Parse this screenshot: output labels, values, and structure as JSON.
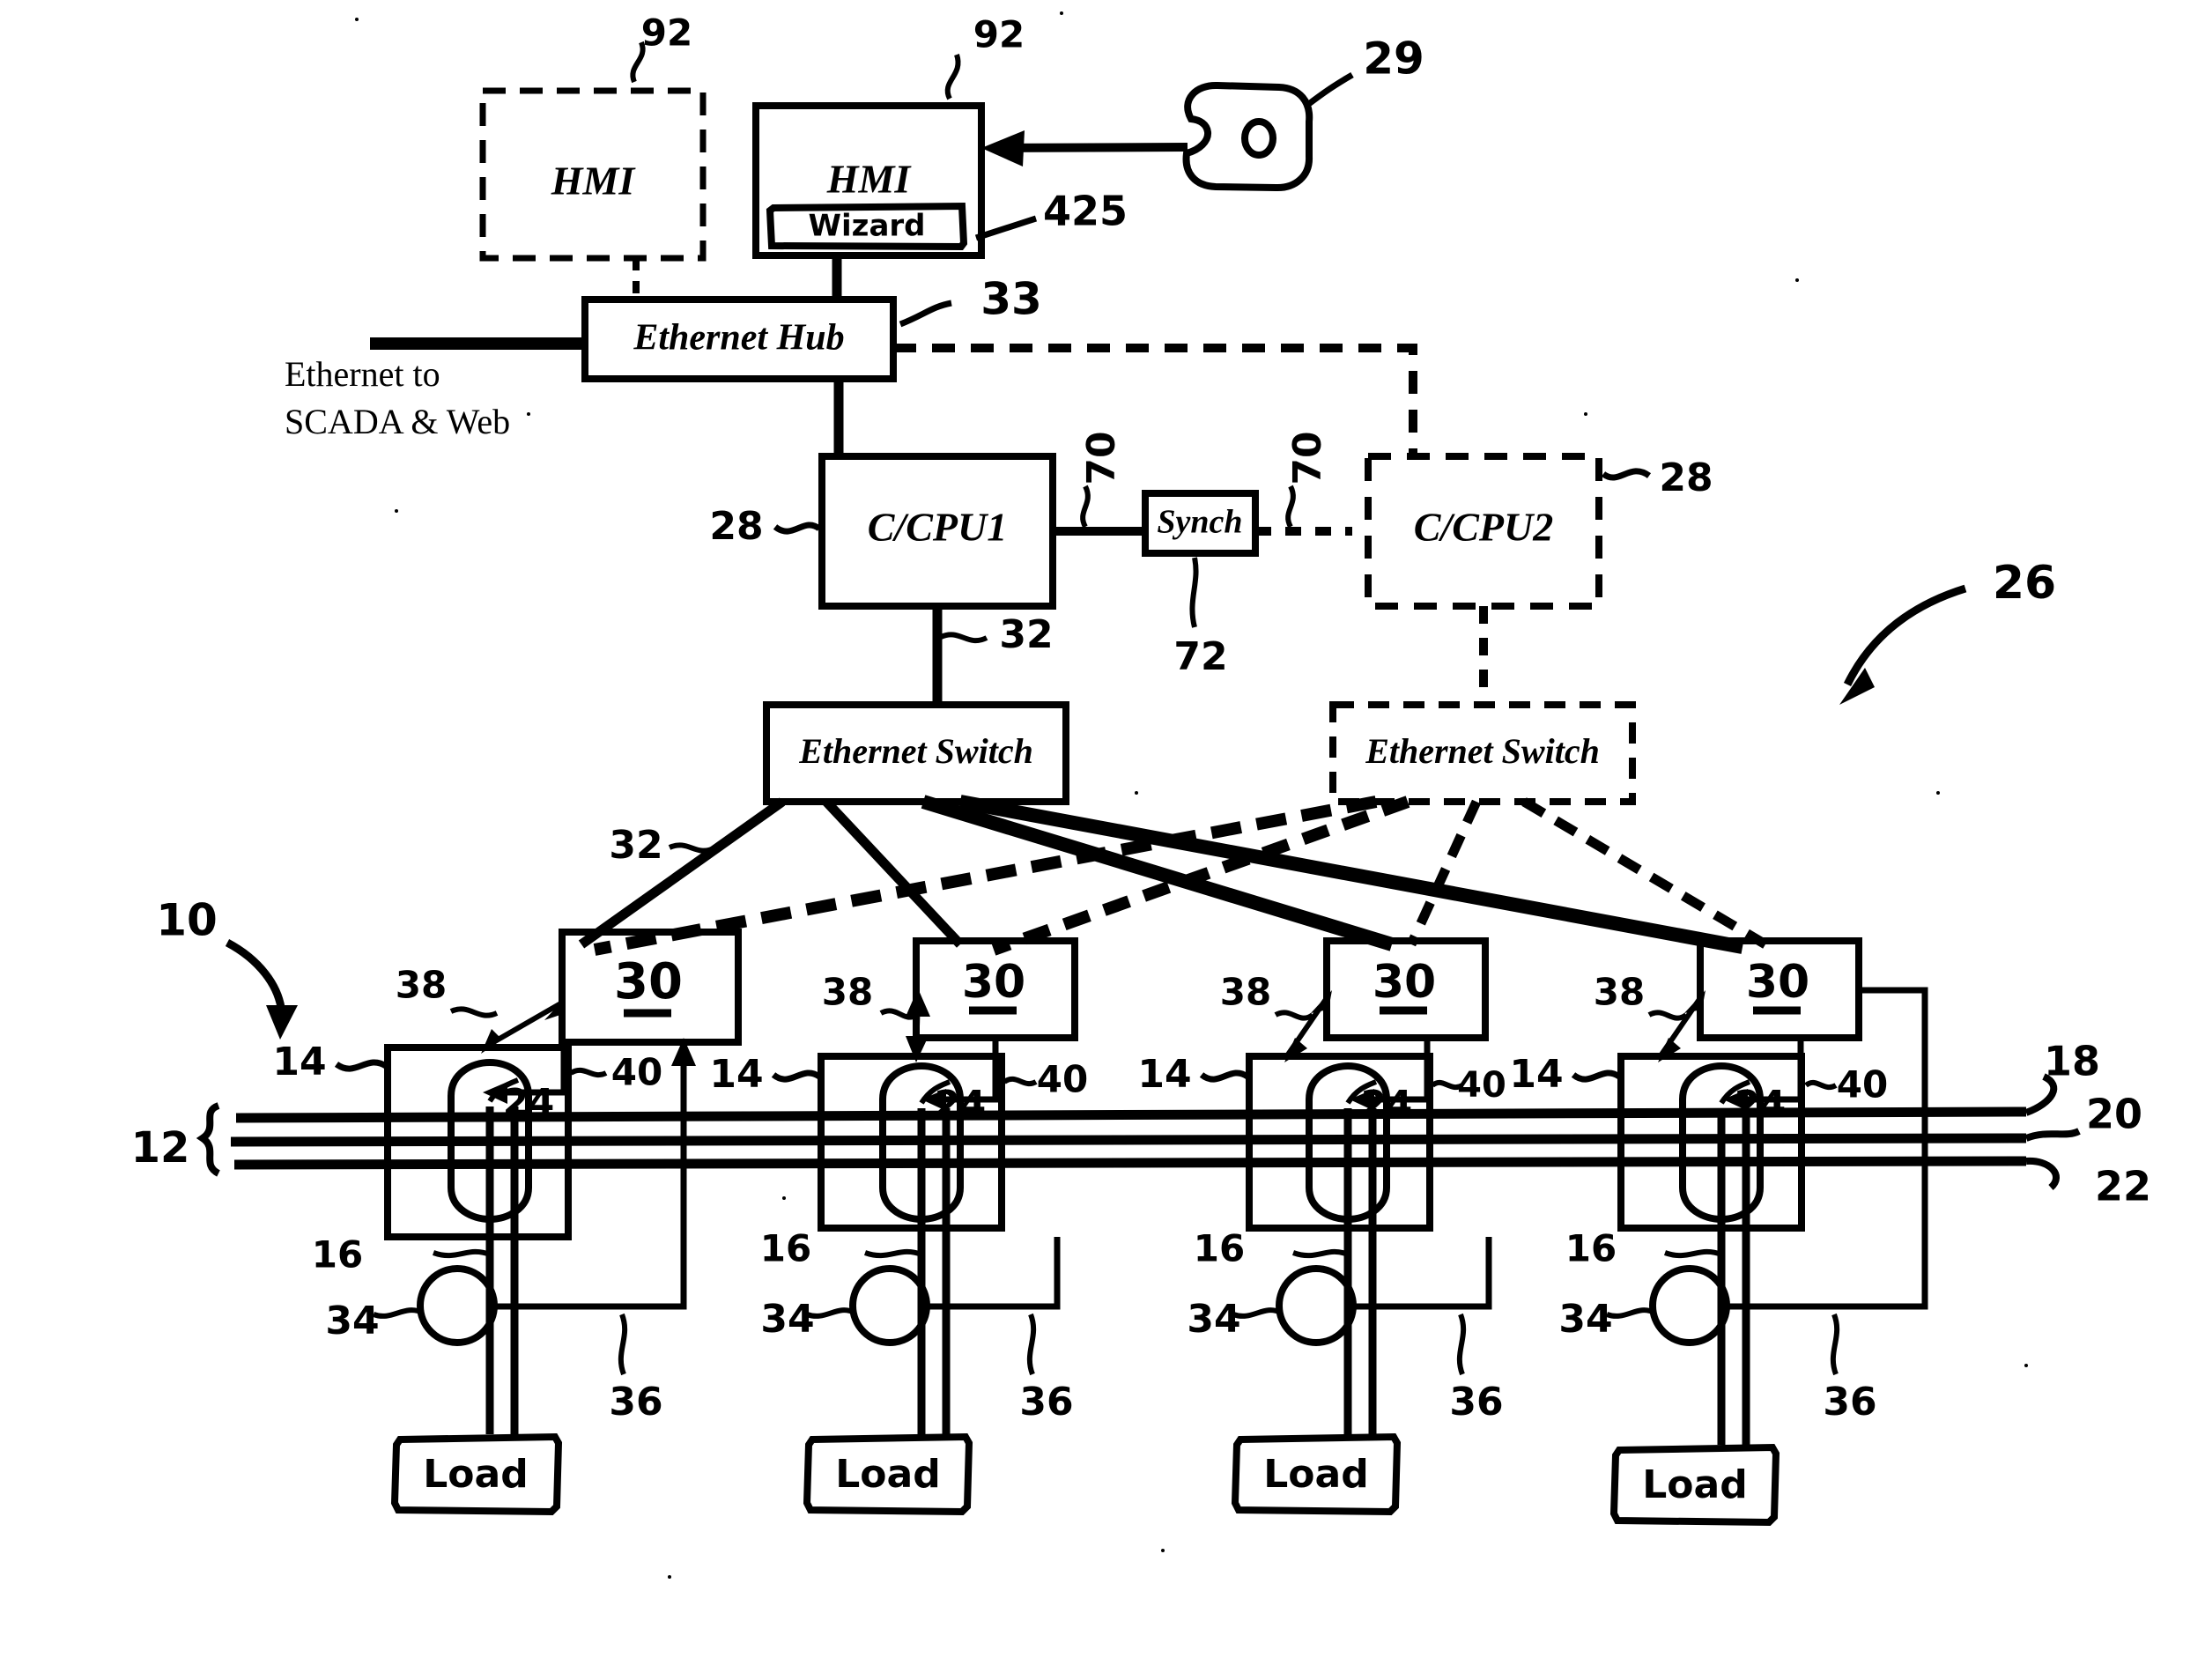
{
  "figure": {
    "kind": "patent-line-drawing",
    "ink_color": "#000000",
    "background_color": "#ffffff"
  },
  "blocks": {
    "hmi_backup": {
      "label": "HMI",
      "style": "dashed"
    },
    "hmi_primary": {
      "label": "HMI",
      "style": "solid"
    },
    "wizard": {
      "label": "Wizard",
      "style": "hand-drawn-box"
    },
    "ethernet_hub": {
      "label": "Ethernet Hub",
      "style": "solid"
    },
    "ccpu1": {
      "label": "C/CPU1",
      "style": "solid"
    },
    "synch": {
      "label": "Synch",
      "style": "solid"
    },
    "ccpu2": {
      "label": "C/CPU2",
      "style": "dashed"
    },
    "switch_primary": {
      "label": "Ethernet Switch",
      "style": "solid"
    },
    "switch_backup": {
      "label": "Ethernet Switch",
      "style": "dashed"
    }
  },
  "annotations": {
    "ethernet_to_scada_line1": "Ethernet to",
    "ethernet_to_scada_line2": "SCADA & Web"
  },
  "reference_numerals": {
    "hmi_backup": "92",
    "hmi_primary": "92",
    "wizard": "425",
    "mouse_pointer_device": "29",
    "ethernet_hub": "33",
    "ccpu1": "28",
    "ccpu2": "28",
    "synch_left_link": "70",
    "synch_right_link": "70",
    "synch": "72",
    "switch_uplink": "32",
    "switch_downlinks": "32",
    "system_overall": "26",
    "assembly_overall": "10",
    "bus_group": "12",
    "enclosure": "14",
    "feeder": "16",
    "bus_phase_a": "18",
    "bus_phase_b": "20",
    "bus_phase_c": "22",
    "breaker": "24",
    "controller_module": "30",
    "sensor_link": "38",
    "trip_link": "40",
    "downstream_device": "34",
    "feedback_link": "36"
  },
  "units": [
    {
      "controller_label": "30",
      "breaker_label": "24",
      "enclosure_label": "14",
      "feeder_label": "16",
      "device_label": "34",
      "feedback_label": "36",
      "sensor_label": "38",
      "trip_label": "40",
      "load_label": "Load"
    },
    {
      "controller_label": "30",
      "breaker_label": "24",
      "enclosure_label": "14",
      "feeder_label": "16",
      "device_label": "34",
      "feedback_label": "36",
      "sensor_label": "38",
      "trip_label": "40",
      "load_label": "Load"
    },
    {
      "controller_label": "30",
      "breaker_label": "24",
      "enclosure_label": "14",
      "feeder_label": "16",
      "device_label": "34",
      "feedback_label": "36",
      "sensor_label": "38",
      "trip_label": "40",
      "load_label": "Load"
    },
    {
      "controller_label": "30",
      "breaker_label": "24",
      "enclosure_label": "14",
      "feeder_label": "16",
      "device_label": "34",
      "feedback_label": "36",
      "sensor_label": "38",
      "trip_label": "40",
      "load_label": "Load"
    }
  ],
  "load_boxes": [
    "Load",
    "Load",
    "Load",
    "Load"
  ]
}
